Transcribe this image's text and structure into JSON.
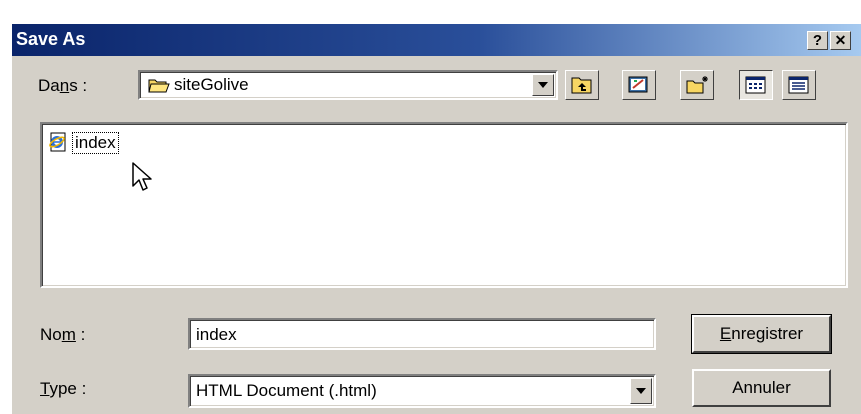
{
  "window": {
    "title": "Save As",
    "help_label": "?",
    "close_label": "✕"
  },
  "look_in": {
    "label_prefix": "Da",
    "label_accel": "n",
    "label_suffix": "s :",
    "value": "siteGolive"
  },
  "toolbar": {
    "icons": [
      "up-one-level-icon",
      "desktop-icon",
      "new-folder-icon",
      "list-view-icon",
      "details-view-icon"
    ]
  },
  "files": [
    {
      "name": "index",
      "icon": "ie-html-document-icon",
      "selected": true
    }
  ],
  "filename": {
    "label_prefix": "No",
    "label_accel": "m",
    "label_suffix": " :",
    "value": "index"
  },
  "filetype": {
    "label_accel": "T",
    "label_suffix": "ype :",
    "value": "HTML Document (.html)"
  },
  "buttons": {
    "save_accel": "E",
    "save_rest": "nregistrer",
    "cancel": "Annuler"
  }
}
